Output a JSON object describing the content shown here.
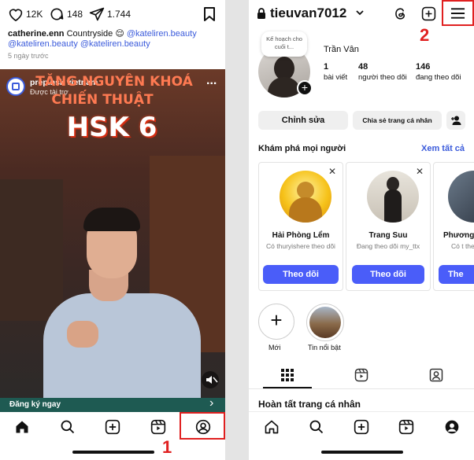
{
  "left": {
    "likes": "12K",
    "comments": "148",
    "shares": "1.744",
    "caption_user": "catherine.enn",
    "caption_text": "Countryside 😌",
    "mention1": "@kateliren.beauty",
    "mention2": "@kateliren.beauty",
    "mention3": "@kateliren.beauty",
    "time_ago": "5 ngày trước",
    "ad_account": "prep.hsk vietnam",
    "ad_sponsored": "Được tài trợ",
    "ad_more": "...",
    "video_title_line1": "TĂNG NGUYÊN KHOÁ",
    "video_title_line2": "CHIẾN THUẬT",
    "video_title_line3": "HSK 6",
    "cta": "Đăng ký ngay",
    "cta_arrow": "›"
  },
  "right": {
    "username": "tieuvan7012",
    "note_bubble": "Kế hoạch cho cuối t...",
    "display_name": "Trần Vân",
    "posts_count": "1",
    "posts_label": "bài viết",
    "followers_count": "48",
    "followers_label": "người theo dõi",
    "following_count": "146",
    "following_label": "đang theo dõi",
    "edit_button": "Chỉnh sửa",
    "share_button": "Chia sẻ trang cá nhân",
    "discover_title": "Khám phá mọi người",
    "see_all": "Xem tất cả",
    "suggestions": [
      {
        "name": "Hải Phòng Lểm",
        "sub": "Có thuryishere theo dõi",
        "button": "Theo dõi"
      },
      {
        "name": "Trang Suu",
        "sub": "Đang theo dõi my_ttx",
        "button": "Theo dõi"
      },
      {
        "name": "Phương",
        "sub": "Có t theo",
        "button": "The"
      }
    ],
    "new_highlight_label": "Mới",
    "highlight_label": "Tin nổi bật",
    "complete_profile": "Hoàn tất trang cá nhân"
  },
  "annotations": {
    "marker1": "1",
    "marker2": "2"
  },
  "colors": {
    "accent_blue": "#4a5df9",
    "link_blue": "#3b5bdb",
    "annotation_red": "#e02020"
  }
}
